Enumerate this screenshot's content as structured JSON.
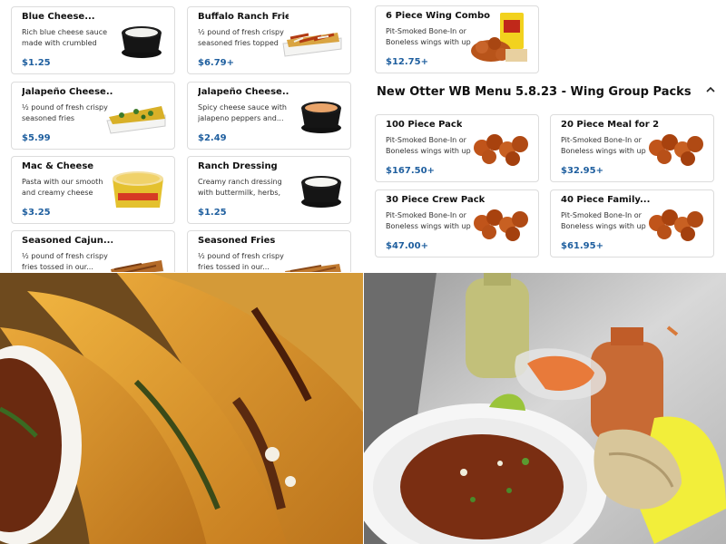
{
  "left_menu": {
    "items": [
      {
        "name": "Blue Cheese...",
        "desc": "Rich blue cheese sauce made with crumbled blue...",
        "price": "$1.25"
      },
      {
        "name": "Buffalo Ranch Fries",
        "desc": "½ pound of fresh crispy seasoned fries topped wit...",
        "price": "$6.79+"
      },
      {
        "name": "Jalapeño Cheese...",
        "desc": "½ pound of fresh crispy seasoned fries smothere...",
        "price": "$5.99"
      },
      {
        "name": "Jalapeño Cheese...",
        "desc": "Spicy cheese sauce with jalapeno peppers and...",
        "price": "$2.49"
      },
      {
        "name": "Mac & Cheese",
        "desc": "Pasta with our smooth and creamy cheese sauce",
        "price": "$3.25"
      },
      {
        "name": "Ranch Dressing",
        "desc": "Creamy ranch dressing with buttermilk, herbs, a...",
        "price": "$1.25"
      },
      {
        "name": "Seasoned Cajun...",
        "desc": "½ pound of fresh crispy fries tossed in our...",
        "price": ""
      },
      {
        "name": "Seasoned Fries",
        "desc": "½ pound of fresh crispy fries tossed in our...",
        "price": ""
      }
    ]
  },
  "right_menu": {
    "top_item": {
      "name": "6 Piece Wing Combo",
      "desc": "Pit-Smoked Bone-In or Boneless wings with up t...",
      "price": "$12.75+"
    },
    "section_title": "New Otter WB Menu 5.8.23 - Wing Group Packs",
    "items": [
      {
        "name": "100 Piece Pack",
        "desc": "Pit-Smoked Bone-In or Boneless wings with up t...",
        "price": "$167.50+"
      },
      {
        "name": "20 Piece Meal for 2",
        "desc": "Pit-Smoked Bone-In or Boneless wings with up t...",
        "price": "$32.95+"
      },
      {
        "name": "30 Piece Crew Pack",
        "desc": "Pit-Smoked Bone-In or Boneless wings with up t...",
        "price": "$47.00+"
      },
      {
        "name": "40 Piece Family...",
        "desc": "Pit-Smoked Bone-In or Boneless wings with up t...",
        "price": "$61.95+"
      }
    ]
  },
  "colors": {
    "price": "#1f5f9f",
    "border": "#dcdcdc",
    "taco_shell": "#d4901e",
    "consomme": "#7a2e12"
  },
  "icons": {
    "section_toggle": "chevron-up-icon"
  }
}
